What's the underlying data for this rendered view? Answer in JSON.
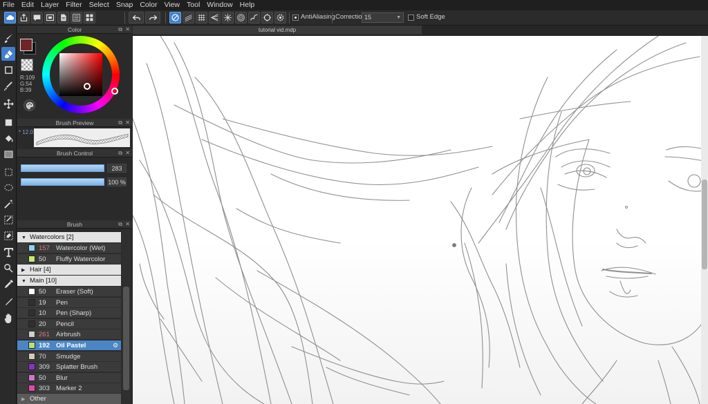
{
  "menu": [
    "File",
    "Edit",
    "Layer",
    "Filter",
    "Select",
    "Snap",
    "Color",
    "View",
    "Tool",
    "Window",
    "Help"
  ],
  "toolbar": {
    "antialiasing_label": "AntiAliasing",
    "correction_label": "Correction",
    "correction_value": "15",
    "soft_edge_label": "Soft Edge",
    "antialiasing_checked": true,
    "soft_edge_checked": false
  },
  "panels": {
    "color_title": "Color",
    "preview_title": "Brush Preview",
    "control_title": "Brush Control",
    "brush_title": "Brush"
  },
  "color": {
    "r": "R:109",
    "g": "G:54",
    "b": "B:39",
    "foreground": "#6d2736",
    "background": "#000000"
  },
  "preview": {
    "size": "* 12.0"
  },
  "brush_control": {
    "size_value": "283",
    "opacity_value": "100 %",
    "size_fraction": 1.0,
    "opacity_fraction": 1.0
  },
  "brush_list": {
    "groups": {
      "watercolors": "Watercolors [2]",
      "hair": "Hair [4]",
      "main": "Main [10]",
      "other": "Other"
    },
    "watercolor_items": [
      {
        "size": "157",
        "name": "Watercolor (Wet)",
        "color": "#8fd2f0",
        "size_color": "#d87a88"
      },
      {
        "size": "50",
        "name": "Fluffy Watercolor",
        "color": "#c8ea6c",
        "size_color": "#dddddd"
      }
    ],
    "main_items": [
      {
        "size": "50",
        "name": "Eraser (Soft)",
        "color": "#ffffff",
        "size_color": "#dddddd"
      },
      {
        "size": "19",
        "name": "Pen",
        "color": "#303030",
        "size_color": "#dddddd"
      },
      {
        "size": "10",
        "name": "Pen (Sharp)",
        "color": "#303030",
        "size_color": "#dddddd"
      },
      {
        "size": "20",
        "name": "Pencil",
        "color": "#303030",
        "size_color": "#dddddd"
      },
      {
        "size": "261",
        "name": "Airbrush",
        "color": "#cfcfcf",
        "size_color": "#d87a88"
      },
      {
        "size": "192",
        "name": "Oil Pastel",
        "color": "#b8e07a",
        "size_color": "#ffffff"
      },
      {
        "size": "70",
        "name": "Smudge",
        "color": "#d9c7be",
        "size_color": "#dddddd"
      },
      {
        "size": "309",
        "name": "Splatter Brush",
        "color": "#8a30c8",
        "size_color": "#dddddd"
      },
      {
        "size": "50",
        "name": "Blur",
        "color": "#d078c8",
        "size_color": "#dddddd"
      },
      {
        "size": "303",
        "name": "Marker 2",
        "color": "#e048b0",
        "size_color": "#dddddd"
      }
    ],
    "selected_index": 5
  },
  "document": {
    "tab_title": "tutorial vid.mdp"
  },
  "icons": {
    "tools": [
      "brush-icon",
      "eraser-icon",
      "rectangle-icon",
      "dot-pen-icon",
      "move-icon",
      "fill-rect-icon",
      "bucket-icon",
      "gradient-icon",
      "select-rect-icon",
      "lasso-icon",
      "magic-wand-icon",
      "select-pen-icon",
      "select-eraser-icon",
      "text-icon",
      "operation-icon",
      "eyedropper-icon",
      "hand-icon"
    ]
  }
}
